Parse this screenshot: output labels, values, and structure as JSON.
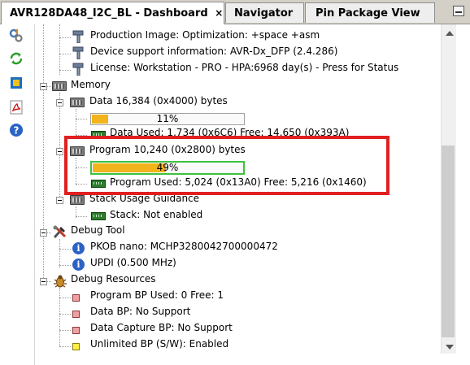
{
  "tabs": [
    {
      "label": "AVR128DA48_I2C_BL - Dashboard",
      "close": "×"
    },
    {
      "label": "Navigator"
    },
    {
      "label": "Pin Package View"
    }
  ],
  "tree": {
    "top_items": [
      "Production Image: Optimization: +space +asm",
      " Device support information: AVR-Dx_DFP (2.4.286)",
      "License: Workstation - PRO - HPA:6968 day(s) - Press for Status"
    ],
    "memory": {
      "label": "Memory",
      "data": {
        "label": "Data 16,384 (0x4000) bytes",
        "percent": 11,
        "percent_label": "11%",
        "used_label": "Data Used: 1,734 (0x6C6) Free: 14,650 (0x393A)"
      },
      "program": {
        "label": "Program 10,240 (0x2800) bytes",
        "percent": 49,
        "percent_label": "49%",
        "used_label": "Program Used: 5,024 (0x13A0) Free: 5,216 (0x1460)"
      },
      "stack": {
        "label": "Stack Usage Guidance",
        "value": "Stack: Not enabled"
      }
    },
    "debug_tool": {
      "label": "Debug Tool",
      "items": [
        "PKOB nano: MCHP3280042700000472",
        "UPDI (0.500 MHz)"
      ]
    },
    "debug_resources": {
      "label": "Debug Resources",
      "items": [
        {
          "label": "Program BP Used: 0  Free: 1",
          "color": "#f0a0a0"
        },
        {
          "label": "Data BP: No Support",
          "color": "#f0a0a0"
        },
        {
          "label": "Data Capture BP: No Support",
          "color": "#f0a0a0"
        },
        {
          "label": "Unlimited BP (S/W): Enabled",
          "color": "#ffee44"
        }
      ]
    }
  },
  "colors": {
    "accent_fill": "#f2b31c",
    "highlight": "#e02020",
    "progress_border": "#3ec13e"
  },
  "icons": {
    "toolbar": [
      "settings-icon",
      "refresh-icon",
      "chip-icon",
      "pdf-icon",
      "help-icon"
    ]
  }
}
